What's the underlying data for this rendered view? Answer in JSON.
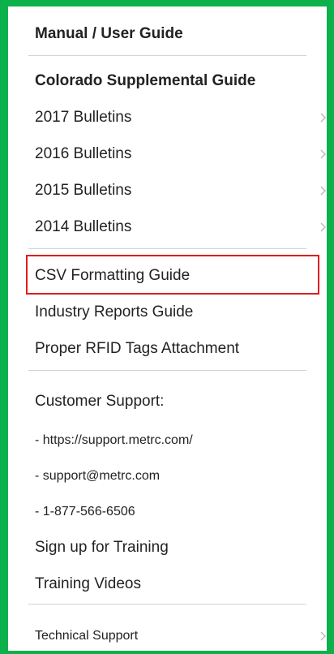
{
  "menu": {
    "manual": "Manual / User Guide",
    "colorado": "Colorado Supplemental Guide",
    "b2017": "2017 Bulletins",
    "b2016": "2016 Bulletins",
    "b2015": "2015 Bulletins",
    "b2014": "2014 Bulletins",
    "csv": "CSV Formatting Guide",
    "industry": "Industry Reports Guide",
    "rfid": "Proper RFID Tags Attachment",
    "support_heading": "Customer Support:",
    "support_url": "- https://support.metrc.com/",
    "support_email": "- support@metrc.com",
    "support_phone": "- 1-877-566-6506",
    "signup": "Sign up for Training",
    "videos": "Training Videos",
    "technical": "Technical Support"
  },
  "colors": {
    "frame": "#0db14b",
    "highlight": "#e01e1e",
    "separator": "#d3d3d3",
    "chevron": "#b5b5b5"
  },
  "icons": {
    "submenu": "chevron-right-icon"
  }
}
